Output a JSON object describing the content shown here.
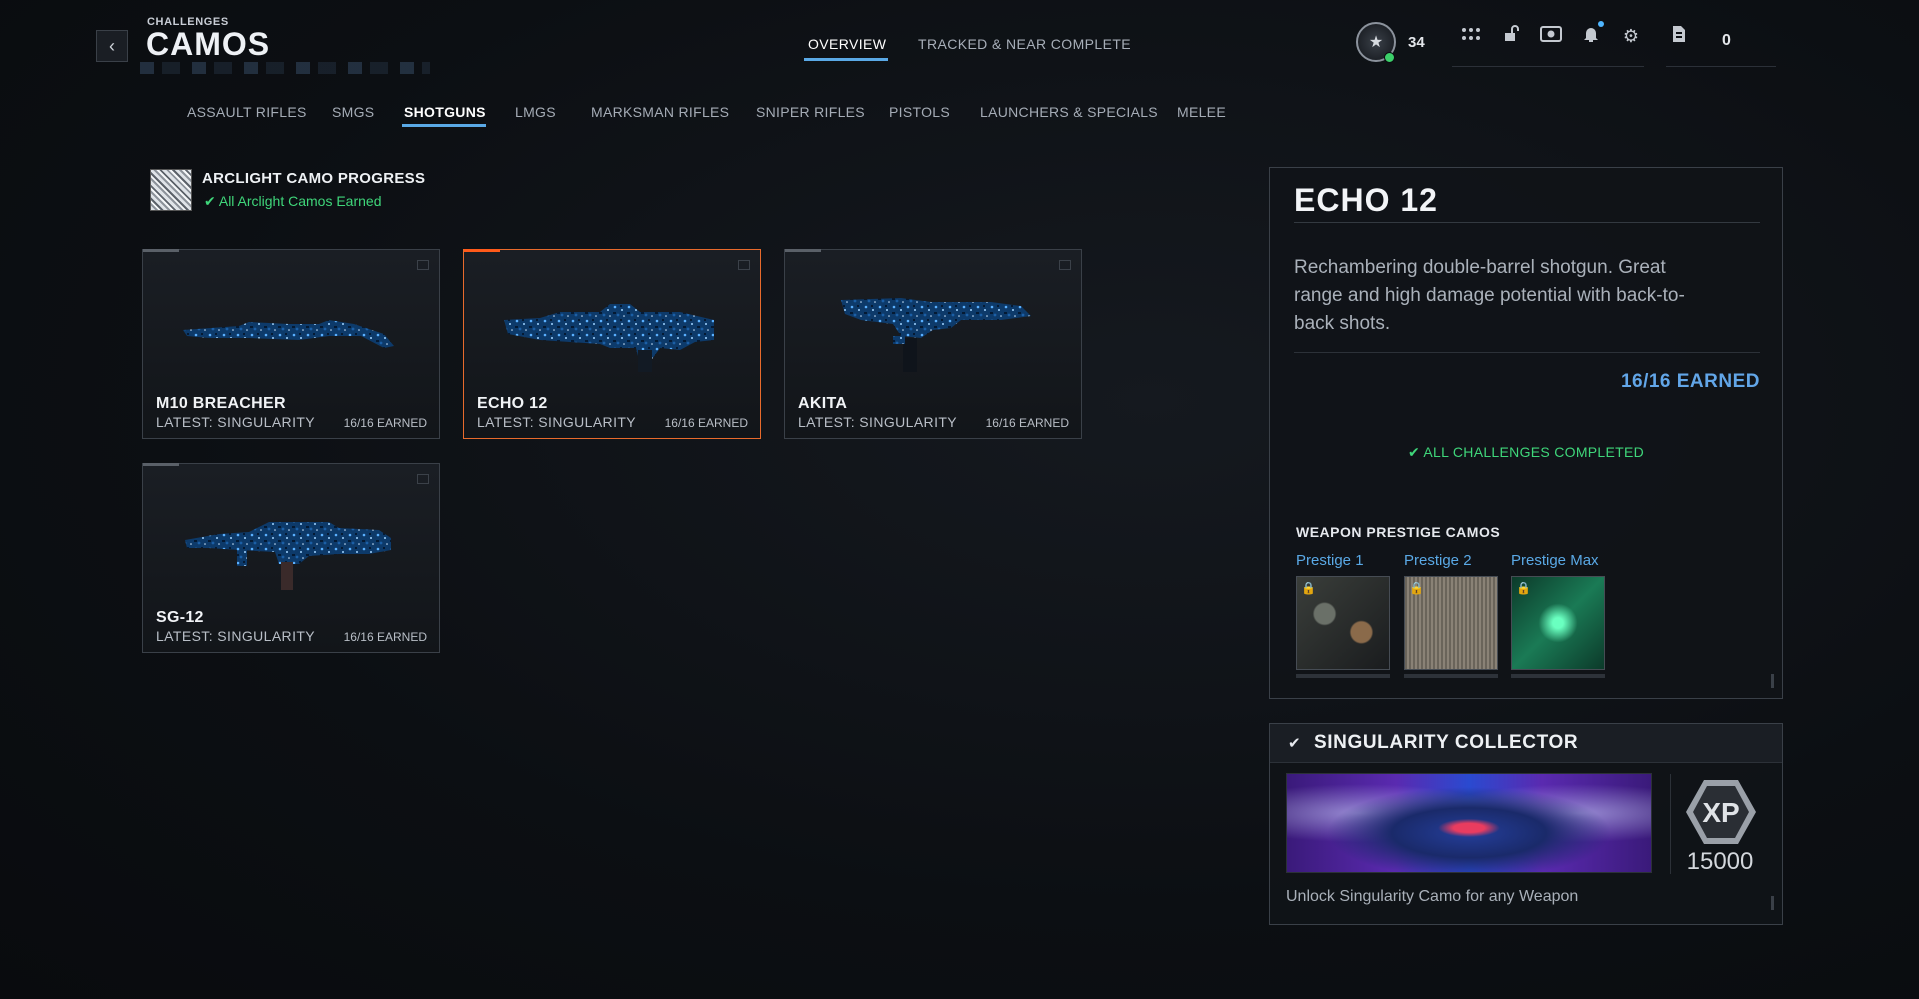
{
  "header": {
    "breadcrumb": "CHALLENGES",
    "title": "CAMOS",
    "tabs": [
      {
        "label": "OVERVIEW",
        "active": true
      },
      {
        "label": "TRACKED & NEAR COMPLETE",
        "active": false
      }
    ],
    "player_level": "34",
    "cp_amount": "0",
    "accent_color": "#5aa9e6",
    "icons": [
      "level-badge-icon",
      "menu-grid-icon",
      "store-icon",
      "intel-icon",
      "notifications-icon",
      "settings-icon",
      "cod-points-icon"
    ]
  },
  "categories": [
    {
      "label": "ASSAULT RIFLES",
      "active": false
    },
    {
      "label": "SMGS",
      "active": false
    },
    {
      "label": "SHOTGUNS",
      "active": true
    },
    {
      "label": "LMGS",
      "active": false
    },
    {
      "label": "MARKSMAN RIFLES",
      "active": false
    },
    {
      "label": "SNIPER RIFLES",
      "active": false
    },
    {
      "label": "PISTOLS",
      "active": false
    },
    {
      "label": "LAUNCHERS & SPECIALS",
      "active": false
    },
    {
      "label": "MELEE",
      "active": false
    }
  ],
  "arclight": {
    "title": "ARCLIGHT CAMO PROGRESS",
    "status": "All Arclight Camos Earned"
  },
  "weapons": [
    {
      "name": "M10 BREACHER",
      "latest": "LATEST: SINGULARITY",
      "earned": "16/16 EARNED",
      "selected": false
    },
    {
      "name": "ECHO 12",
      "latest": "LATEST: SINGULARITY",
      "earned": "16/16 EARNED",
      "selected": true
    },
    {
      "name": "AKITA",
      "latest": "LATEST: SINGULARITY",
      "earned": "16/16 EARNED",
      "selected": false
    },
    {
      "name": "SG-12",
      "latest": "LATEST: SINGULARITY",
      "earned": "16/16 EARNED",
      "selected": false
    }
  ],
  "detail": {
    "title": "ECHO 12",
    "description": "Rechambering double-barrel shotgun. Great range and high damage potential with back-to-back shots.",
    "earned": "16/16 EARNED",
    "complete": "ALL CHALLENGES COMPLETED",
    "prestige_heading": "WEAPON PRESTIGE CAMOS",
    "prestige": [
      {
        "label": "Prestige 1"
      },
      {
        "label": "Prestige 2"
      },
      {
        "label": "Prestige Max"
      }
    ]
  },
  "collector": {
    "title": "SINGULARITY COLLECTOR",
    "xp_label": "XP",
    "xp": "15000",
    "description": "Unlock Singularity Camo for any Weapon"
  }
}
